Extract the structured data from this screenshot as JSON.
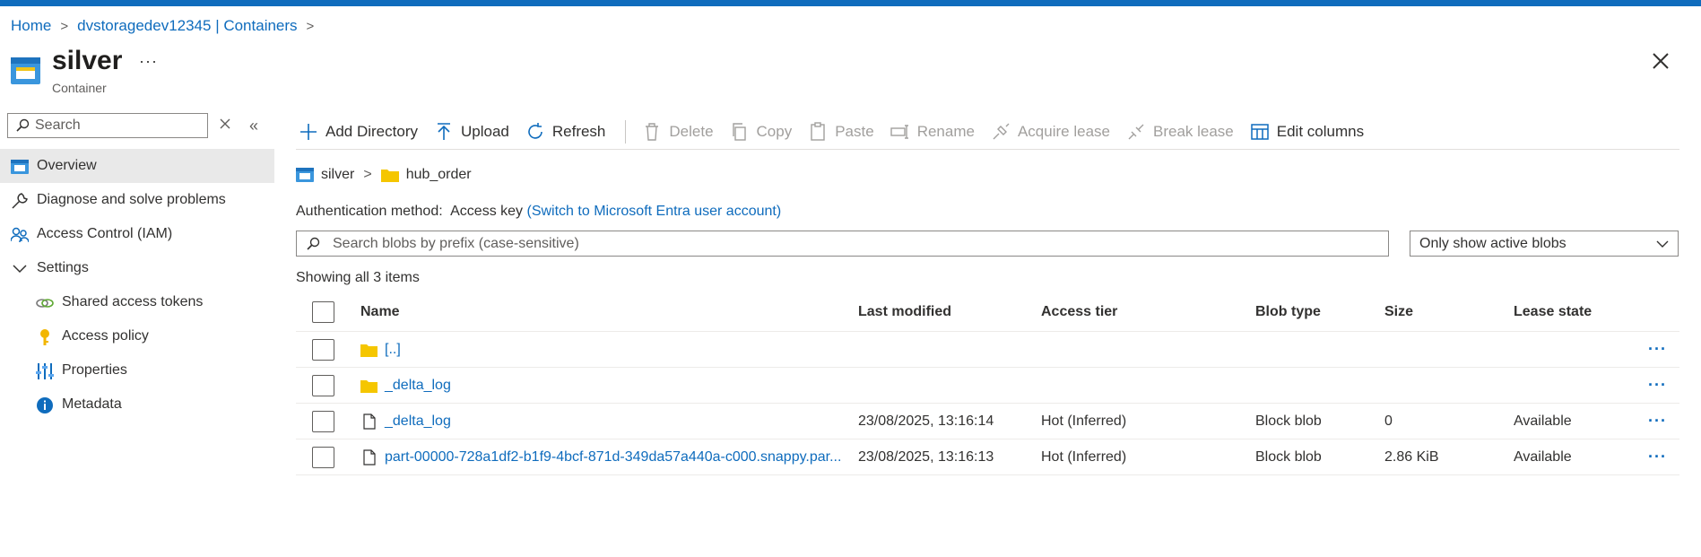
{
  "breadcrumb": {
    "home": "Home",
    "account": "dvstoragedev12345 | Containers",
    "sep": ">"
  },
  "header": {
    "title": "silver",
    "subtitle": "Container",
    "more": "···"
  },
  "sidebar": {
    "search_placeholder": "Search",
    "collapse": "«",
    "items": [
      {
        "label": "Overview",
        "icon": "container-icon",
        "active": true
      },
      {
        "label": "Diagnose and solve problems",
        "icon": "wrench-icon"
      },
      {
        "label": "Access Control (IAM)",
        "icon": "people-icon"
      },
      {
        "label": "Settings",
        "icon": "chevron-down-icon"
      },
      {
        "label": "Shared access tokens",
        "icon": "link-icon"
      },
      {
        "label": "Access policy",
        "icon": "key-icon"
      },
      {
        "label": "Properties",
        "icon": "properties-icon"
      },
      {
        "label": "Metadata",
        "icon": "info-icon"
      }
    ]
  },
  "toolbar": {
    "add_directory": "Add Directory",
    "upload": "Upload",
    "refresh": "Refresh",
    "delete": "Delete",
    "copy": "Copy",
    "paste": "Paste",
    "rename": "Rename",
    "acquire_lease": "Acquire lease",
    "break_lease": "Break lease",
    "edit_columns": "Edit columns"
  },
  "path": {
    "container": "silver",
    "folder": "hub_order"
  },
  "auth": {
    "label": "Authentication method:",
    "value": "Access key",
    "switch_link": "(Switch to Microsoft Entra user account)"
  },
  "blob_search": {
    "placeholder": "Search blobs by prefix (case-sensitive)"
  },
  "filter": {
    "selected": "Only show active blobs"
  },
  "count_text": "Showing all 3 items",
  "table": {
    "columns": {
      "name": "Name",
      "modified": "Last modified",
      "tier": "Access tier",
      "type": "Blob type",
      "size": "Size",
      "lease": "Lease state"
    },
    "rows": [
      {
        "name": "[..]",
        "kind": "folder",
        "modified": "",
        "tier": "",
        "type": "",
        "size": "",
        "lease": "",
        "more": "···"
      },
      {
        "name": "_delta_log",
        "kind": "folder",
        "modified": "",
        "tier": "",
        "type": "",
        "size": "",
        "lease": "",
        "more": "···"
      },
      {
        "name": "_delta_log",
        "kind": "file",
        "modified": "23/08/2025, 13:16:14",
        "tier": "Hot (Inferred)",
        "type": "Block blob",
        "size": "0",
        "lease": "Available",
        "more": "···"
      },
      {
        "name": "part-00000-728a1df2-b1f9-4bcf-871d-349da57a440a-c000.snappy.par...",
        "kind": "file",
        "modified": "23/08/2025, 13:16:13",
        "tier": "Hot (Inferred)",
        "type": "Block blob",
        "size": "2.86 KiB",
        "lease": "Available",
        "more": "···"
      }
    ]
  },
  "colors": {
    "accent": "#0f6cbd",
    "folder": "#f5c600",
    "disabled": "#a19f9d"
  }
}
